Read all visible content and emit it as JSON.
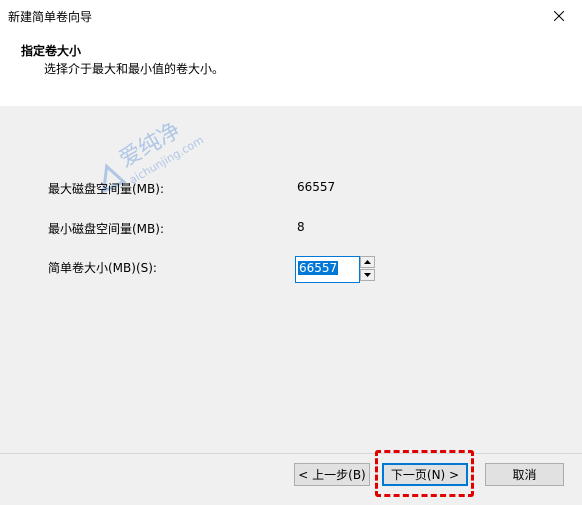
{
  "window": {
    "title": "新建简单卷向导",
    "close_glyph": "✕"
  },
  "header": {
    "title": "指定卷大小",
    "subtitle": "选择介于最大和最小值的卷大小。"
  },
  "fields": {
    "max_label": "最大磁盘空间量(MB):",
    "max_value": "66557",
    "min_label": "最小磁盘空间量(MB):",
    "min_value": "8",
    "size_label": "简单卷大小(MB)(S):",
    "size_value": "66557"
  },
  "watermark": {
    "text1": "爱纯净",
    "text2": "aichunjing.com"
  },
  "buttons": {
    "back": "< 上一步(B)",
    "next": "下一页(N) >",
    "cancel": "取消"
  },
  "colors": {
    "accent": "#0078d7",
    "highlight": "#e00000",
    "panel": "#f0f0f0"
  }
}
